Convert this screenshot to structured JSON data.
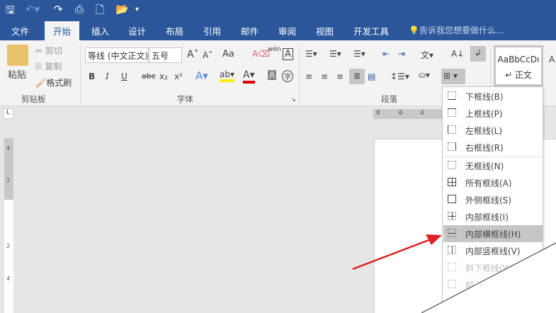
{
  "quick_access": {
    "save_icon": "save-icon",
    "undo_icon": "undo-icon",
    "redo_icon": "redo-icon",
    "print_preview_icon": "print-preview-icon",
    "new_icon": "new-doc-icon",
    "open_icon": "open-folder-icon",
    "customize_icon": "customize-icon"
  },
  "tabs": [
    "文件",
    "开始",
    "插入",
    "设计",
    "布局",
    "引用",
    "邮件",
    "审阅",
    "视图",
    "开发工具"
  ],
  "tell_me": "告诉我您想要做什么...",
  "clipboard": {
    "paste": "粘贴",
    "cut": "剪切",
    "copy": "复制",
    "format_painter": "格式刷",
    "group": "剪贴板"
  },
  "font": {
    "name": "等线 (中文正文)",
    "size": "五号",
    "case": "Aa",
    "pinyin": "wén",
    "group": "字体",
    "bold": "B",
    "italic": "I",
    "underline": "U",
    "strike": "abc",
    "sub": "x₂",
    "sup": "x²",
    "enclose": "字"
  },
  "paragraph": {
    "group": "段落"
  },
  "styles": {
    "sample": "AaBbCcDı",
    "name": "↵ 正文"
  },
  "ruler": {
    "marks": [
      "8",
      "6",
      "4"
    ]
  },
  "vruler": {
    "marks": [
      "4",
      "2",
      "2",
      "4"
    ]
  },
  "border_menu": {
    "items": [
      {
        "label": "下框线(B)",
        "state": "normal"
      },
      {
        "label": "上框线(P)",
        "state": "normal"
      },
      {
        "label": "左框线(L)",
        "state": "normal"
      },
      {
        "label": "右框线(R)",
        "state": "normal"
      },
      {
        "label": "无框线(N)",
        "state": "normal"
      },
      {
        "label": "所有框线(A)",
        "state": "normal"
      },
      {
        "label": "外侧框线(S)",
        "state": "normal"
      },
      {
        "label": "内部框线(I)",
        "state": "normal"
      },
      {
        "label": "内部横框线(H)",
        "state": "highlighted"
      },
      {
        "label": "内部竖框线(V)",
        "state": "normal"
      },
      {
        "label": "斜下框线(W)",
        "state": "disabled"
      },
      {
        "label": "斜上框线(U)",
        "state": "disabled"
      }
    ]
  },
  "colors": {
    "brand": "#2b579a",
    "arrow": "#e02020",
    "highlight": "#c6c6c6"
  }
}
